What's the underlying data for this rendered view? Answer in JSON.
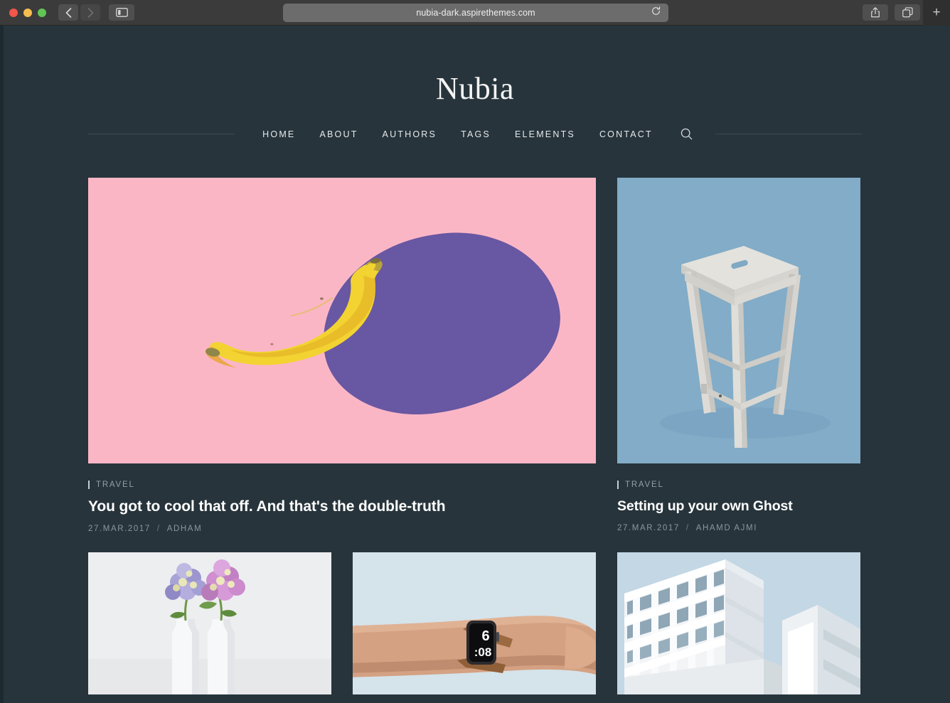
{
  "browser": {
    "url": "nubia-dark.aspirethemes.com",
    "back_icon": "chevron-left-icon",
    "forward_icon": "chevron-right-icon",
    "sidebar_icon": "sidebar-toggle-icon",
    "reload_icon": "reload-icon",
    "share_icon": "share-icon",
    "tabs_icon": "show-tabs-icon",
    "new_tab_label": "+"
  },
  "site": {
    "title": "Nubia",
    "nav": [
      {
        "label": "HOME",
        "name": "nav-home"
      },
      {
        "label": "ABOUT",
        "name": "nav-about"
      },
      {
        "label": "AUTHORS",
        "name": "nav-authors"
      },
      {
        "label": "TAGS",
        "name": "nav-tags"
      },
      {
        "label": "ELEMENTS",
        "name": "nav-elements"
      },
      {
        "label": "CONTACT",
        "name": "nav-contact"
      }
    ],
    "search_icon": "search-icon"
  },
  "posts": {
    "featured": {
      "tag": "TRAVEL",
      "title": "You got to cool that off. And that's the double-truth",
      "date": "27.MAR.2017",
      "separator": "/",
      "author": "ADHAM",
      "image": "banana-on-pink-background"
    },
    "secondary": {
      "tag": "TRAVEL",
      "title": "Setting up your own Ghost",
      "date": "27.MAR.2017",
      "separator": "/",
      "author": "AHAMD AJMI",
      "image": "white-stool-on-blue-background"
    },
    "row2": [
      {
        "image": "purple-hydrangeas-in-white-vases"
      },
      {
        "image": "arm-wearing-smartwatch",
        "watch_time": "6:08"
      },
      {
        "image": "white-modern-building-against-blue-sky"
      }
    ]
  },
  "colors": {
    "page_background": "#27343b",
    "text_primary": "#ffffff",
    "text_muted": "#8b979e",
    "rule": "#3c4a51",
    "chrome": "#3b3b3b",
    "pink": "#fbb6c6",
    "banana_yellow": "#f2d331",
    "shadow_purple": "#5b4f9e",
    "stool_blue": "#82acc7",
    "sky_blue": "#c3d7e4"
  }
}
